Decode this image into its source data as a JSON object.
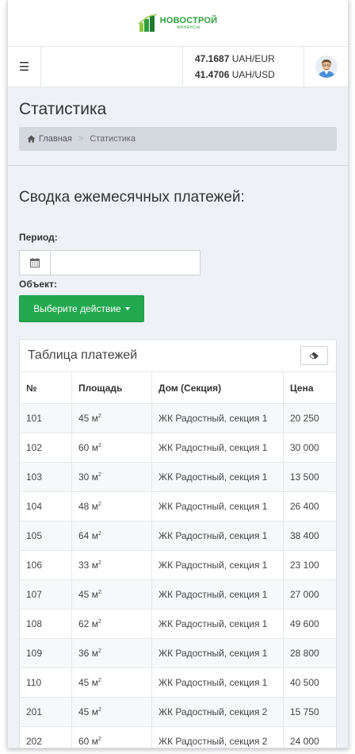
{
  "brand": {
    "name": "НОВОСТРОЙ",
    "sub": "ФИНАНСЫ",
    "color": "#2e9e3c"
  },
  "topnav": {
    "menu_icon": "hamburger-icon",
    "rates": [
      {
        "value": "47.1687",
        "unit": "UAH/EUR"
      },
      {
        "value": "41.4706",
        "unit": "UAH/USD"
      }
    ]
  },
  "page": {
    "title": "Статистика",
    "breadcrumb": {
      "home": "Главная",
      "separator": ">",
      "current": "Статистика"
    }
  },
  "summary": {
    "title": "Сводка ежемесячных платежей:",
    "period_label": "Период:",
    "period_value": "",
    "object_label": "Объект:",
    "action_button": "Выберите действие",
    "accent": "#22a84e"
  },
  "table": {
    "title": "Таблица платежей",
    "headers": [
      "№",
      "Площадь",
      "Дом (Секция)",
      "Цена"
    ],
    "area_unit": "м",
    "area_exp": "2",
    "rows": [
      {
        "num": "101",
        "area": "45",
        "house": "ЖК Радостный, секция 1",
        "price": "20 250"
      },
      {
        "num": "102",
        "area": "60",
        "house": "ЖК Радостный, секция 1",
        "price": "30 000"
      },
      {
        "num": "103",
        "area": "30",
        "house": "ЖК Радостный, секция 1",
        "price": "13 500"
      },
      {
        "num": "104",
        "area": "48",
        "house": "ЖК Радостный, секция 1",
        "price": "26 400"
      },
      {
        "num": "105",
        "area": "64",
        "house": "ЖК Радостный, секция 1",
        "price": "38 400"
      },
      {
        "num": "106",
        "area": "33",
        "house": "ЖК Радостный, секция 1",
        "price": "23 100"
      },
      {
        "num": "107",
        "area": "45",
        "house": "ЖК Радостный, секция 1",
        "price": "27 000"
      },
      {
        "num": "108",
        "area": "62",
        "house": "ЖК Радостный, секция 1",
        "price": "49 600"
      },
      {
        "num": "109",
        "area": "36",
        "house": "ЖК Радостный, секция 1",
        "price": "28 800"
      },
      {
        "num": "110",
        "area": "45",
        "house": "ЖК Радостный, секция 1",
        "price": "40 500"
      },
      {
        "num": "201",
        "area": "45",
        "house": "ЖК Радостный, секция 2",
        "price": "15 750"
      },
      {
        "num": "202",
        "area": "60",
        "house": "ЖК Радостный, секция 2",
        "price": "24 000"
      }
    ]
  }
}
